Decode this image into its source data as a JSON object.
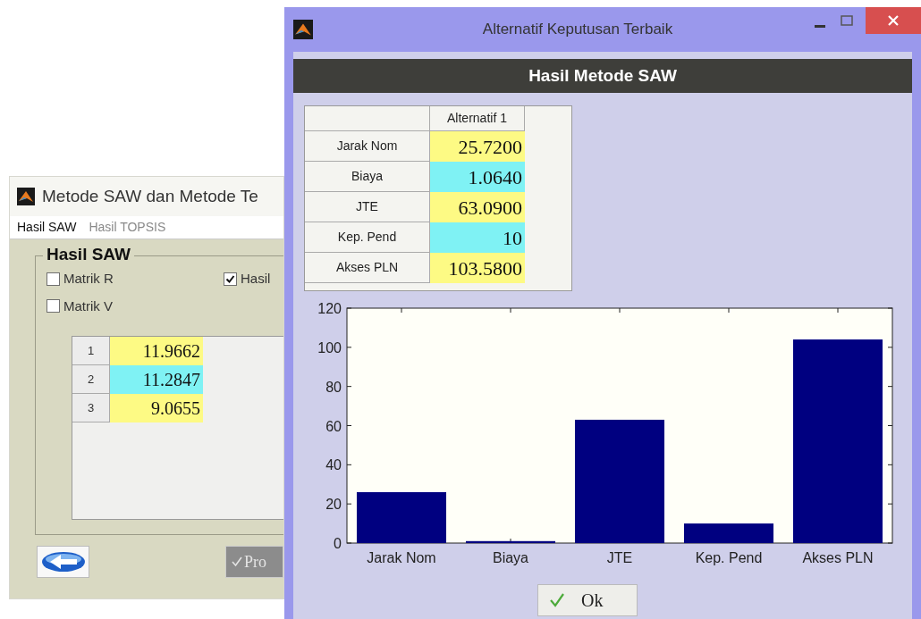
{
  "back_window": {
    "title": "Metode SAW dan Metode Te",
    "menu": [
      {
        "label": "Hasil SAW",
        "disabled": false
      },
      {
        "label": "Hasil TOPSIS",
        "disabled": true
      }
    ],
    "group": {
      "title": "Hasil SAW",
      "checkboxes": [
        {
          "label": "Matrik R",
          "checked": false
        },
        {
          "label": "Hasil",
          "checked": true
        },
        {
          "label": "Matrik V",
          "checked": false
        }
      ],
      "table": {
        "rows": [
          {
            "header": "1",
            "value": "11.9662",
            "color": "#fdfa84"
          },
          {
            "header": "2",
            "value": "11.2847",
            "color": "#7ff2f4"
          },
          {
            "header": "3",
            "value": "9.0655",
            "color": "#fdfa84"
          }
        ]
      }
    },
    "buttons": [
      {
        "kind": "icon",
        "disabled": false
      },
      {
        "kind": "text",
        "label": "Pro",
        "disabled": true
      }
    ]
  },
  "front_window": {
    "title": "Alternatif Keputusan Terbaik",
    "header": "Hasil Metode SAW",
    "table": {
      "columns": [
        "Alternatif 1"
      ],
      "rows": [
        {
          "label": "Jarak Nom",
          "value": "25.7200",
          "color": "#fdfa84"
        },
        {
          "label": "Biaya",
          "value": "1.0640",
          "color": "#7ff2f4"
        },
        {
          "label": "JTE",
          "value": "63.0900",
          "color": "#fdfa84"
        },
        {
          "label": "Kep. Pend",
          "value": "10",
          "color": "#7ff2f4"
        },
        {
          "label": "Akses PLN",
          "value": "103.5800",
          "color": "#fdfa84"
        }
      ]
    },
    "chart_data": {
      "type": "bar",
      "categories": [
        "Jarak Nom",
        "Biaya",
        "JTE",
        "Kep. Pend",
        "Akses PLN"
      ],
      "series": [
        {
          "color": "#000080",
          "values": [
            26,
            1,
            63,
            10,
            104
          ]
        }
      ],
      "ylim": [
        0,
        120
      ],
      "yticks": [
        0,
        20,
        40,
        60,
        80,
        100,
        120
      ]
    },
    "ok_button": "Ok"
  }
}
